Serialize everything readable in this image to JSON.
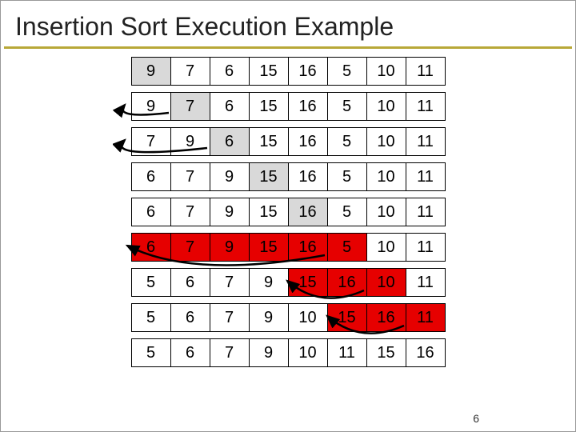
{
  "title": "Insertion Sort Execution Example",
  "page_number": "6",
  "colors": {
    "gray": "#d9d9d9",
    "red": "#e60000",
    "accent": "#b8a838"
  },
  "chart_data": {
    "type": "table",
    "title": "Insertion Sort Execution Example",
    "rows": [
      {
        "values": [
          9,
          7,
          6,
          15,
          16,
          5,
          10,
          11
        ],
        "highlight": {
          "color": "gray",
          "indices": [
            0
          ]
        }
      },
      {
        "values": [
          9,
          7,
          6,
          15,
          16,
          5,
          10,
          11
        ],
        "highlight": {
          "color": "gray",
          "indices": [
            1
          ]
        }
      },
      {
        "values": [
          7,
          9,
          6,
          15,
          16,
          5,
          10,
          11
        ],
        "highlight": {
          "color": "gray",
          "indices": [
            2
          ]
        }
      },
      {
        "values": [
          6,
          7,
          9,
          15,
          16,
          5,
          10,
          11
        ],
        "highlight": {
          "color": "gray",
          "indices": [
            3
          ]
        }
      },
      {
        "values": [
          6,
          7,
          9,
          15,
          16,
          5,
          10,
          11
        ],
        "highlight": {
          "color": "gray",
          "indices": [
            4
          ]
        }
      },
      {
        "values": [
          6,
          7,
          9,
          15,
          16,
          5,
          10,
          11
        ],
        "highlight": {
          "color": "red",
          "indices": [
            0,
            1,
            2,
            3,
            4,
            5
          ]
        }
      },
      {
        "values": [
          5,
          6,
          7,
          9,
          15,
          16,
          10,
          11
        ],
        "highlight": {
          "color": "red",
          "indices": [
            4,
            5,
            6
          ]
        }
      },
      {
        "values": [
          5,
          6,
          7,
          9,
          10,
          15,
          16,
          11
        ],
        "highlight": {
          "color": "red",
          "indices": [
            5,
            6,
            7
          ]
        }
      },
      {
        "values": [
          5,
          6,
          7,
          9,
          10,
          11,
          15,
          16
        ],
        "highlight": null
      }
    ]
  }
}
